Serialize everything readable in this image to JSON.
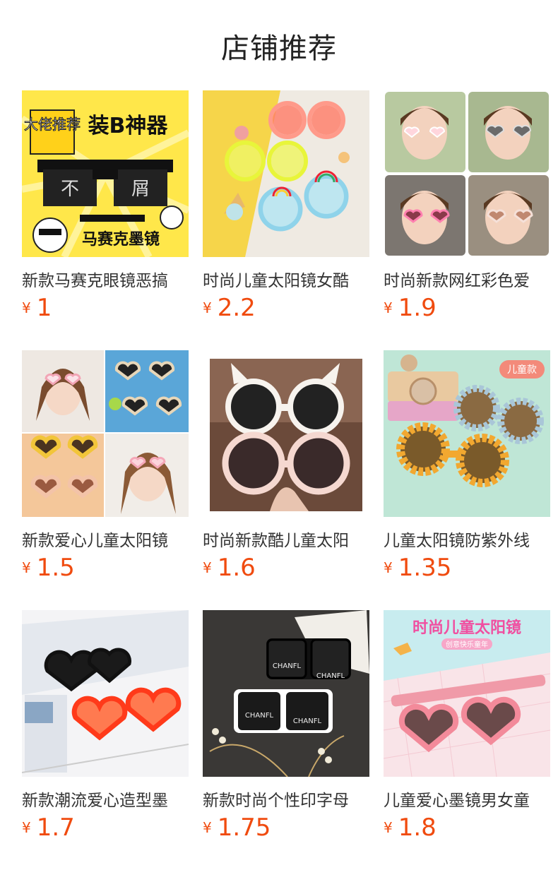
{
  "header": {
    "title": "店铺推荐"
  },
  "products": [
    {
      "name": "新款马赛克眼镜恶搞",
      "currency": "¥",
      "price": "1",
      "image": "pixel-sunglasses-meme",
      "badge_text": "大佬推荐",
      "headline": "装B神器",
      "lens_left": "不",
      "lens_right": "屑",
      "caption": "马赛克墨镜"
    },
    {
      "name": "时尚儿童太阳镜女酷",
      "currency": "¥",
      "price": "2.2",
      "image": "rainbow-kids-sunglasses"
    },
    {
      "name": "时尚新款网红彩色爱",
      "currency": "¥",
      "price": "1.9",
      "image": "girls-heart-sunglasses-collage"
    },
    {
      "name": "新款爱心儿童太阳镜",
      "currency": "¥",
      "price": "1.5",
      "image": "heart-sunglasses-collage"
    },
    {
      "name": "时尚新款酷儿童太阳",
      "currency": "¥",
      "price": "1.6",
      "image": "cat-ear-round-sunglasses"
    },
    {
      "name": "儿童太阳镜防紫外线",
      "currency": "¥",
      "price": "1.35",
      "image": "flower-kids-sunglasses",
      "tag_text": "儿童款"
    },
    {
      "name": "新款潮流爱心造型墨",
      "currency": "¥",
      "price": "1.7",
      "image": "red-black-heart-sunglasses"
    },
    {
      "name": "新款时尚个性印字母",
      "currency": "¥",
      "price": "1.75",
      "image": "chanfl-square-sunglasses",
      "lens_text": "CHANFL"
    },
    {
      "name": "儿童爱心墨镜男女童",
      "currency": "¥",
      "price": "1.8",
      "image": "pink-pixel-heart-sunglasses",
      "banner_title": "时尚儿童太阳镜",
      "banner_sub": "创意快乐童年"
    }
  ],
  "colors": {
    "price": "#f04b0f",
    "title": "#222222",
    "name": "#333333"
  }
}
